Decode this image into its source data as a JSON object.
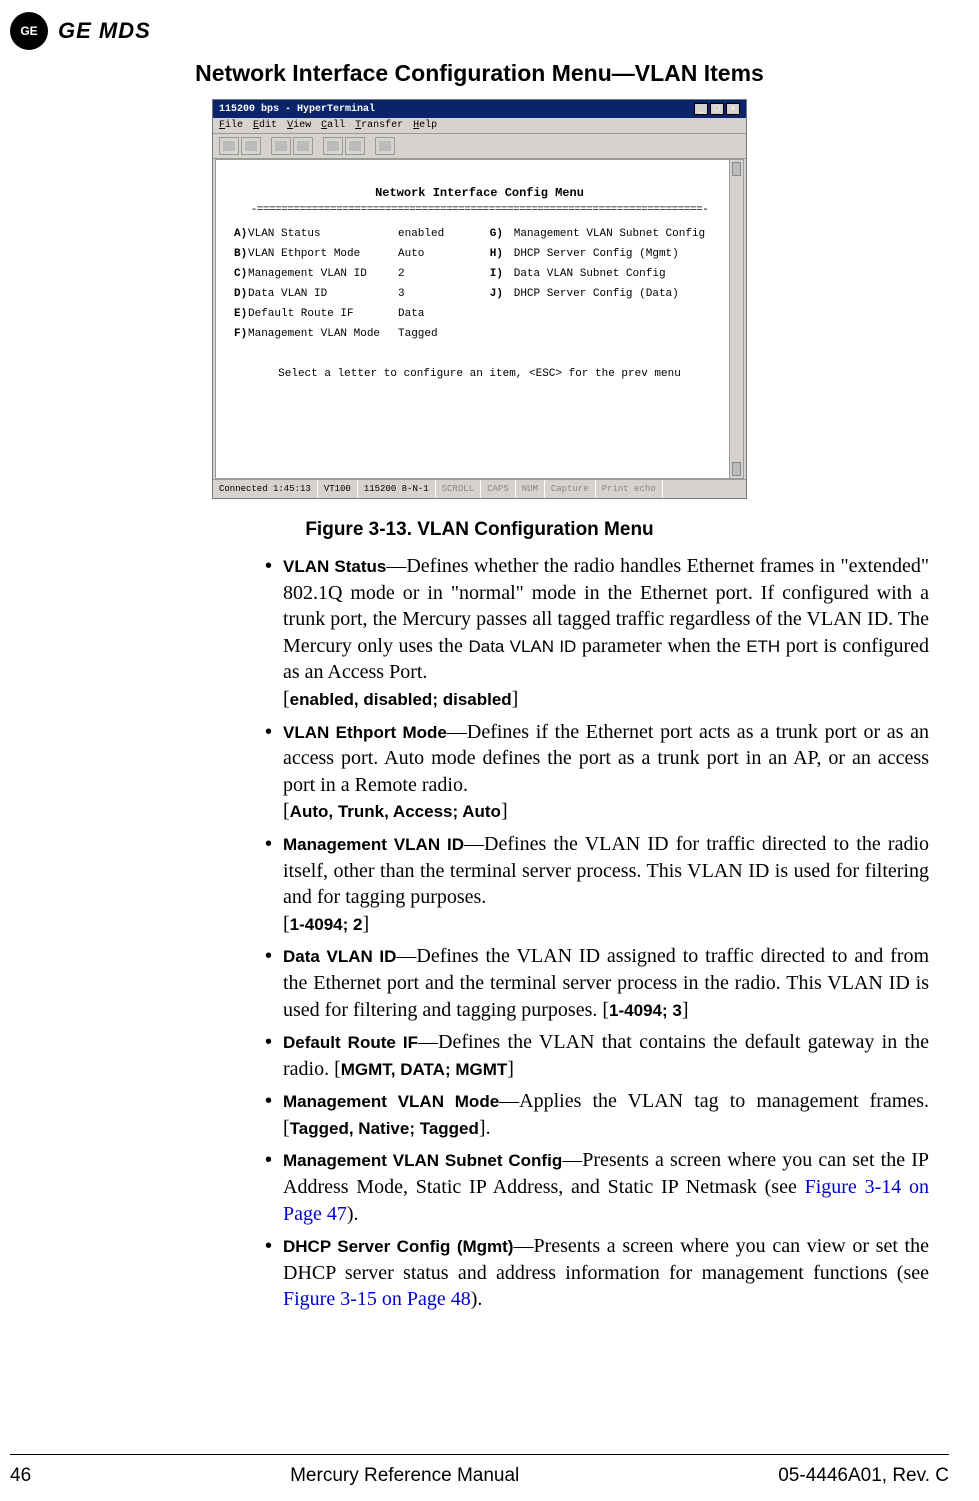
{
  "header": {
    "logo_text": "GE",
    "brand": "GE MDS"
  },
  "page_title": "Network Interface Configuration Menu—VLAN Items",
  "terminal": {
    "window_title": "115200 bps - HyperTerminal",
    "menus": {
      "file": "File",
      "edit": "Edit",
      "view": "View",
      "call": "Call",
      "transfer": "Transfer",
      "help": "Help"
    },
    "heading": "Network Interface Config Menu",
    "divider": "-=========================================================================-",
    "items_left": [
      {
        "key": "A",
        "label": "VLAN Status",
        "value": "enabled"
      },
      {
        "key": "B",
        "label": "VLAN Ethport Mode",
        "value": "Auto"
      },
      {
        "key": "C",
        "label": "Management VLAN ID",
        "value": "2"
      },
      {
        "key": "D",
        "label": "Data VLAN ID",
        "value": "3"
      },
      {
        "key": "E",
        "label": "Default Route IF",
        "value": "Data"
      },
      {
        "key": "F",
        "label": "Management VLAN Mode",
        "value": "Tagged"
      }
    ],
    "items_right": [
      {
        "key": "G",
        "label": "Management VLAN Subnet Config"
      },
      {
        "key": "H",
        "label": "DHCP Server Config (Mgmt)"
      },
      {
        "key": "I",
        "label": "Data VLAN Subnet Config"
      },
      {
        "key": "J",
        "label": "DHCP Server Config (Data)"
      }
    ],
    "select_hint": "Select a letter to configure an item, <ESC> for the prev menu",
    "status": {
      "connected": "Connected 1:45:13",
      "emulation": "VT100",
      "settings": "115200 8-N-1",
      "scroll": "SCROLL",
      "caps": "CAPS",
      "num": "NUM",
      "capture": "Capture",
      "printecho": "Print echo"
    }
  },
  "figure_caption": "Figure 3-13. VLAN Configuration Menu",
  "bullets": [
    {
      "term": "VLAN Status",
      "body": "—Defines whether the radio handles Ethernet frames in \"extended\" 802.1Q mode or in \"normal\" mode in the Ethernet port. If configured with a trunk port, the Mercury passes all tagged traffic regardless of the VLAN ID. The Mercury only uses the ",
      "mono1": "Data VLAN ID",
      "body2": " parameter when the ",
      "mono2": "ETH",
      "body3": " port is configured as an Access Port.",
      "params": "enabled, disabled; disabled"
    },
    {
      "term": "VLAN Ethport Mode",
      "body": "—Defines if the Ethernet port acts as a trunk port or as an access port. Auto mode defines the port as a trunk port in an AP, or an access port in a Remote radio.",
      "params": "Auto, Trunk, Access; Auto"
    },
    {
      "term": "Management VLAN ID",
      "body": "—Defines the VLAN ID for traffic directed to the radio itself, other than the terminal server process. This VLAN ID is used for filtering and for tagging purposes.",
      "params": "1-4094; 2"
    },
    {
      "term": "Data VLAN ID",
      "body": "—Defines the VLAN ID assigned to traffic directed to and from the Ethernet port and the terminal server process in the radio. This VLAN ID is used for filtering and tagging purposes. ",
      "params_inline": "1-4094; 3"
    },
    {
      "term": "Default Route IF",
      "body": "—Defines the VLAN that contains the default gateway in the radio. ",
      "params_inline": "MGMT, DATA; MGMT"
    },
    {
      "term": "Management VLAN Mode",
      "body": "—Applies the VLAN tag to management frames. ",
      "params_inline": "Tagged, Native; Tagged",
      "trailing": "."
    },
    {
      "term": "Management VLAN Subnet Config",
      "body": "—Presents a screen where you can set the IP Address Mode, Static IP Address, and Static IP Netmask (see ",
      "link": "Figure 3-14 on Page 47",
      "body_after": ")."
    },
    {
      "term": "DHCP Server Config (Mgmt)",
      "body": "—Presents a screen where you can view or set the DHCP server status and address information for management functions (see ",
      "link": "Figure 3-15 on Page 48",
      "body_after": ")."
    }
  ],
  "footer": {
    "page": "46",
    "center": "Mercury Reference Manual",
    "right": "05-4446A01, Rev. C"
  }
}
